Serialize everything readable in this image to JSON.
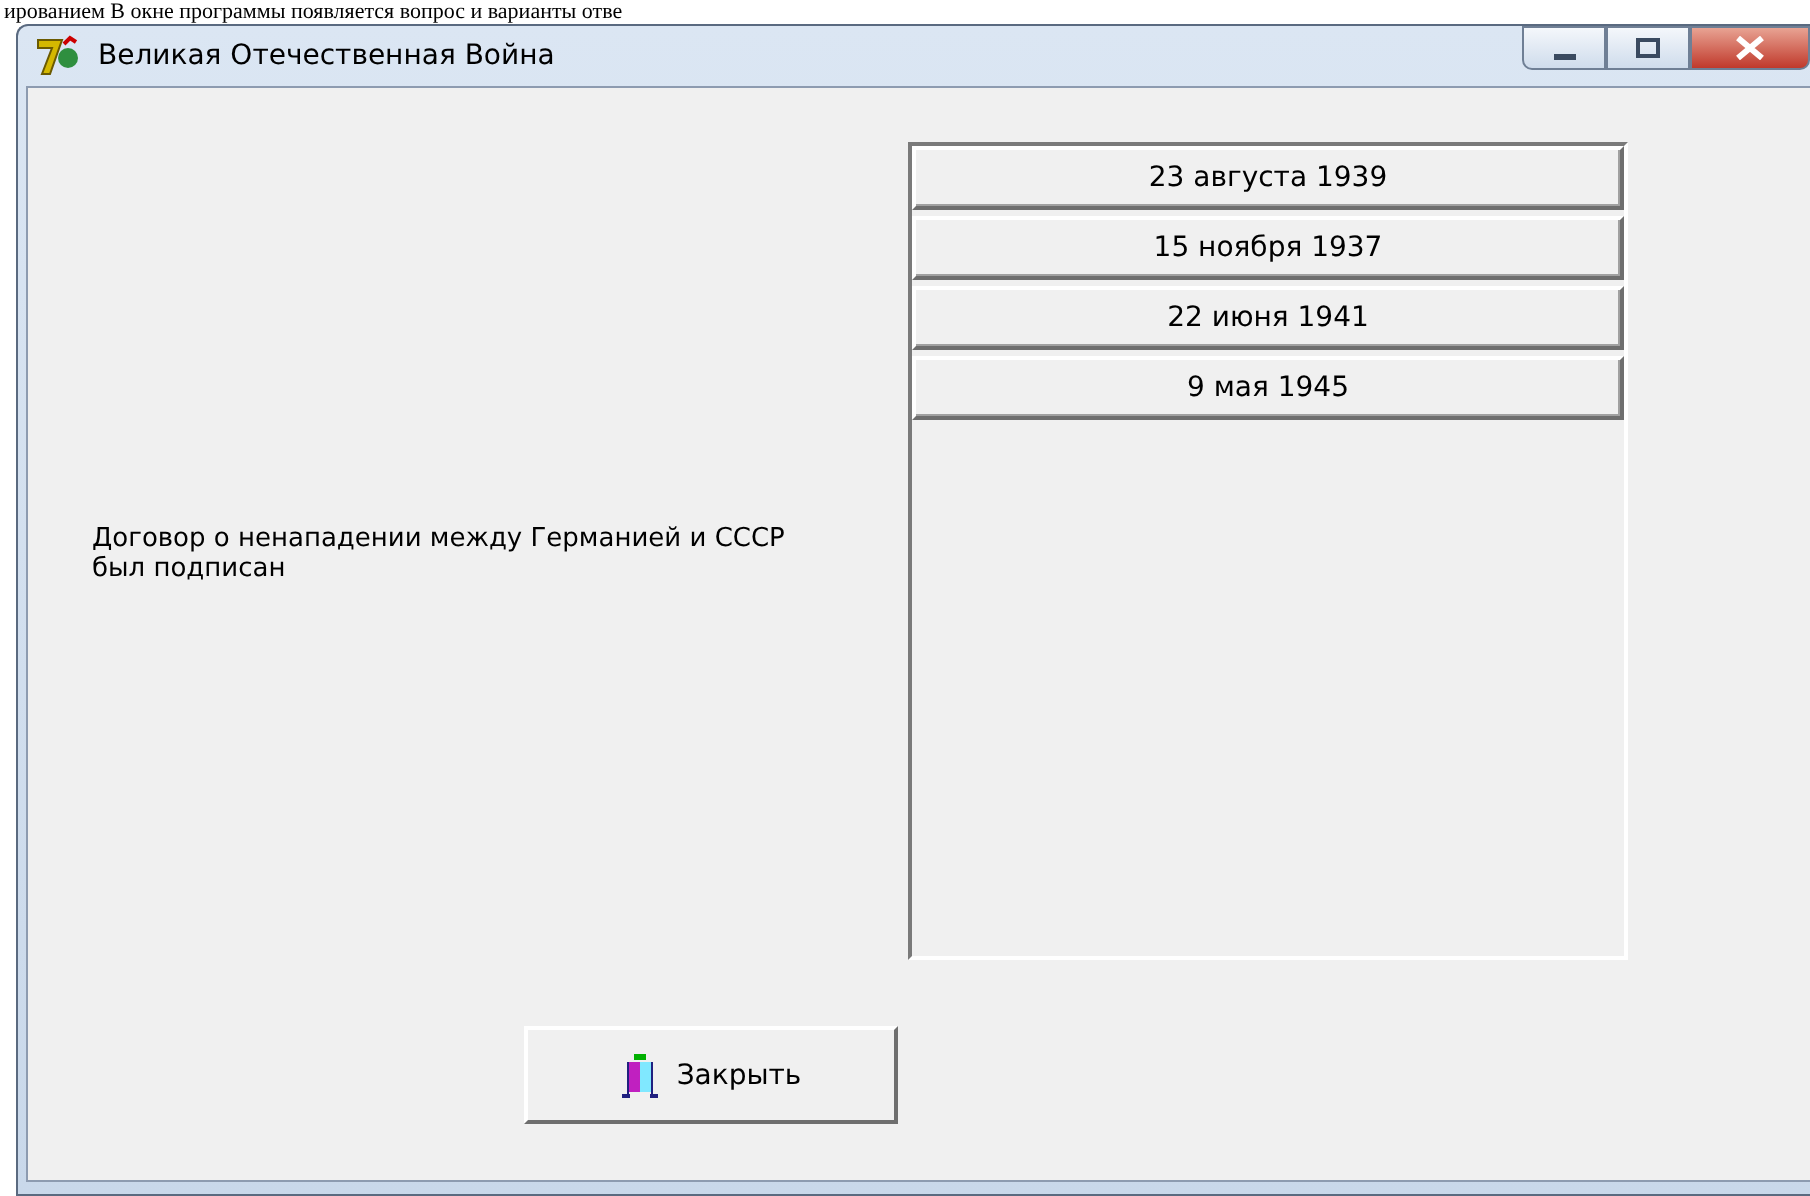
{
  "document_text": "ированием В окне программы появляется вопрос и варианты отве",
  "window": {
    "title": "Великая Отечественная Война"
  },
  "question": "Договор о ненападении между Германией и СССР был подписан",
  "answers": [
    {
      "label": "23 августа 1939"
    },
    {
      "label": "15 ноября 1937"
    },
    {
      "label": "22 июня 1941"
    },
    {
      "label": "9 мая 1945"
    }
  ],
  "close_button": "Закрыть"
}
